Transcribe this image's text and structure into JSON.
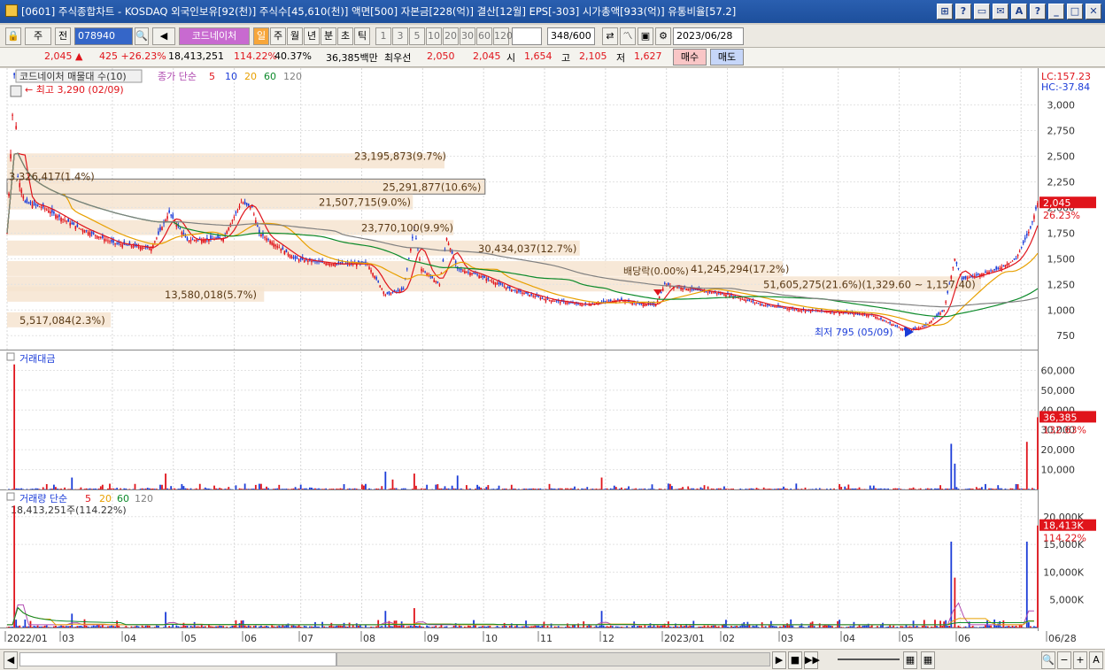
{
  "window": {
    "title": "[0601] 주식종합차트 - KOSDAQ 외국인보유[92(천)] 주식수[45,610(천)] 액면[500] 자본금[228(억)] 결산[12월] EPS[-303] 시가총액[933(억)] 유통비율[57.2]",
    "buttons": [
      "⊞",
      "?",
      "▭",
      "✉",
      "A",
      "?",
      "_",
      "□",
      "✕"
    ]
  },
  "toolbar": {
    "market": "주",
    "prev": "전",
    "code": "078940",
    "stock_name": "코드네이처",
    "periods": [
      "일",
      "주",
      "월",
      "년",
      "분",
      "초",
      "틱"
    ],
    "intervals": [
      "1",
      "3",
      "5",
      "10",
      "20",
      "30",
      "60",
      "120"
    ],
    "count": "348",
    "count_total": "/600",
    "date": "2023/06/28"
  },
  "quote": {
    "price": "2,045 ▲",
    "change": "425 +26.23%",
    "volume": "18,413,251",
    "vol_ratio": "114.22%",
    "turnover": "40.37%",
    "amount": "36,385백만",
    "best_label": "최우선",
    "best_sell": "2,050",
    "best_buy": "2,045",
    "open_label": "시",
    "open": "1,654",
    "high_label": "고",
    "high": "2,105",
    "low_label": "저",
    "low": "1,627",
    "buy_btn": "매수",
    "sell_btn": "매도"
  },
  "price_panel": {
    "title": "코드네이처 매물대 수(10)",
    "ma_label": "종가 단순",
    "ma": [
      "5",
      "10",
      "20",
      "60",
      "120"
    ],
    "ma_colors": [
      "#e0141b",
      "#1b3cd8",
      "#e8a000",
      "#0c8a2a",
      "#808080"
    ],
    "lc": "LC:157.23",
    "hc": "HC:-37.84",
    "high_note": "← 최고 3,290 (02/09)",
    "low_note": "최저 795 (05/09)",
    "ex_div": "배당락(0.00%)",
    "last_price": "2,045",
    "last_pct": "26.23%",
    "y_ticks": [
      "3,000",
      "2,750",
      "2,500",
      "2,250",
      "2,000",
      "1,750",
      "1,500",
      "1,250",
      "1,000",
      "750"
    ],
    "volume_profile": [
      {
        "label": "23,195,873(9.7%)",
        "pct": 9.7
      },
      {
        "label": "3,326,417(1.4%)",
        "pct": 1.4
      },
      {
        "label": "25,291,877(10.6%)",
        "pct": 10.6
      },
      {
        "label": "21,507,715(9.0%)",
        "pct": 9.0
      },
      {
        "label": "23,770,100(9.9%)",
        "pct": 9.9
      },
      {
        "label": "30,434,037(12.7%)",
        "pct": 12.7
      },
      {
        "label": "41,245,294(17.2%)",
        "pct": 17.2
      },
      {
        "label": "51,605,275(21.6%)(1,329.60 ~ 1,157.40)",
        "pct": 21.6
      },
      {
        "label": "13,580,018(5.7%)",
        "pct": 5.7
      },
      {
        "label": "5,517,084(2.3%)",
        "pct": 2.3
      }
    ]
  },
  "amount_panel": {
    "title": "거래대금",
    "y_ticks": [
      "60,000",
      "50,000",
      "40,000",
      "30,000",
      "20,000",
      "10,000"
    ],
    "last": "36,385",
    "last_pct": "132.63%"
  },
  "volume_panel": {
    "title": "거래량 단순",
    "ma": [
      "5",
      "20",
      "60",
      "120"
    ],
    "current": "18,413,251주(114.22%)",
    "y_ticks": [
      "20,000K",
      "15,000K",
      "10,000K",
      "5,000K"
    ],
    "last": "18,413K",
    "last_pct": "114.22%"
  },
  "x_axis": [
    "2022/01",
    "03",
    "04",
    "05",
    "06",
    "07",
    "08",
    "09",
    "10",
    "11",
    "12",
    "2023/01",
    "02",
    "03",
    "04",
    "05",
    "06",
    "06/28"
  ],
  "chart_data": {
    "type": "candlestick",
    "title": "코드네이처 매물대 수(10)",
    "x_range": [
      "2022/01",
      "2023/06/28"
    ],
    "price_ylim": [
      750,
      3290
    ],
    "price_path": [
      [
        0,
        1750
      ],
      [
        4,
        3290
      ],
      [
        6,
        2300
      ],
      [
        10,
        2050
      ],
      [
        20,
        2000
      ],
      [
        40,
        1800
      ],
      [
        60,
        1650
      ],
      [
        80,
        1600
      ],
      [
        90,
        1950
      ],
      [
        100,
        1680
      ],
      [
        120,
        1700
      ],
      [
        130,
        2050
      ],
      [
        136,
        2000
      ],
      [
        140,
        1750
      ],
      [
        160,
        1500
      ],
      [
        180,
        1450
      ],
      [
        200,
        1450
      ],
      [
        210,
        1150
      ],
      [
        220,
        1200
      ],
      [
        226,
        1800
      ],
      [
        230,
        1400
      ],
      [
        240,
        1250
      ],
      [
        244,
        1700
      ],
      [
        250,
        1400
      ],
      [
        260,
        1350
      ],
      [
        280,
        1200
      ],
      [
        300,
        1100
      ],
      [
        320,
        1050
      ],
      [
        340,
        1100
      ],
      [
        350,
        1060
      ],
      [
        360,
        1050
      ],
      [
        365,
        1250
      ],
      [
        380,
        1200
      ],
      [
        400,
        1150
      ],
      [
        420,
        1050
      ],
      [
        440,
        1000
      ],
      [
        460,
        980
      ],
      [
        480,
        950
      ],
      [
        490,
        870
      ],
      [
        500,
        795
      ],
      [
        510,
        850
      ],
      [
        520,
        1000
      ],
      [
        526,
        1500
      ],
      [
        530,
        1300
      ],
      [
        540,
        1350
      ],
      [
        550,
        1400
      ],
      [
        560,
        1500
      ],
      [
        568,
        1800
      ],
      [
        572,
        2045
      ]
    ],
    "amount_spikes": [
      [
        4,
        63000
      ],
      [
        36,
        6000
      ],
      [
        88,
        8000
      ],
      [
        210,
        9000
      ],
      [
        214,
        5000
      ],
      [
        226,
        8000
      ],
      [
        250,
        7000
      ],
      [
        330,
        6000
      ],
      [
        524,
        23000
      ],
      [
        526,
        13000
      ],
      [
        566,
        24000
      ],
      [
        572,
        36385
      ]
    ],
    "volume_spikes": [
      [
        4,
        22000
      ],
      [
        36,
        2500
      ],
      [
        88,
        2800
      ],
      [
        210,
        3000
      ],
      [
        226,
        3500
      ],
      [
        330,
        3000
      ],
      [
        524,
        15500
      ],
      [
        526,
        9000
      ],
      [
        566,
        15500
      ],
      [
        572,
        18413
      ]
    ]
  }
}
